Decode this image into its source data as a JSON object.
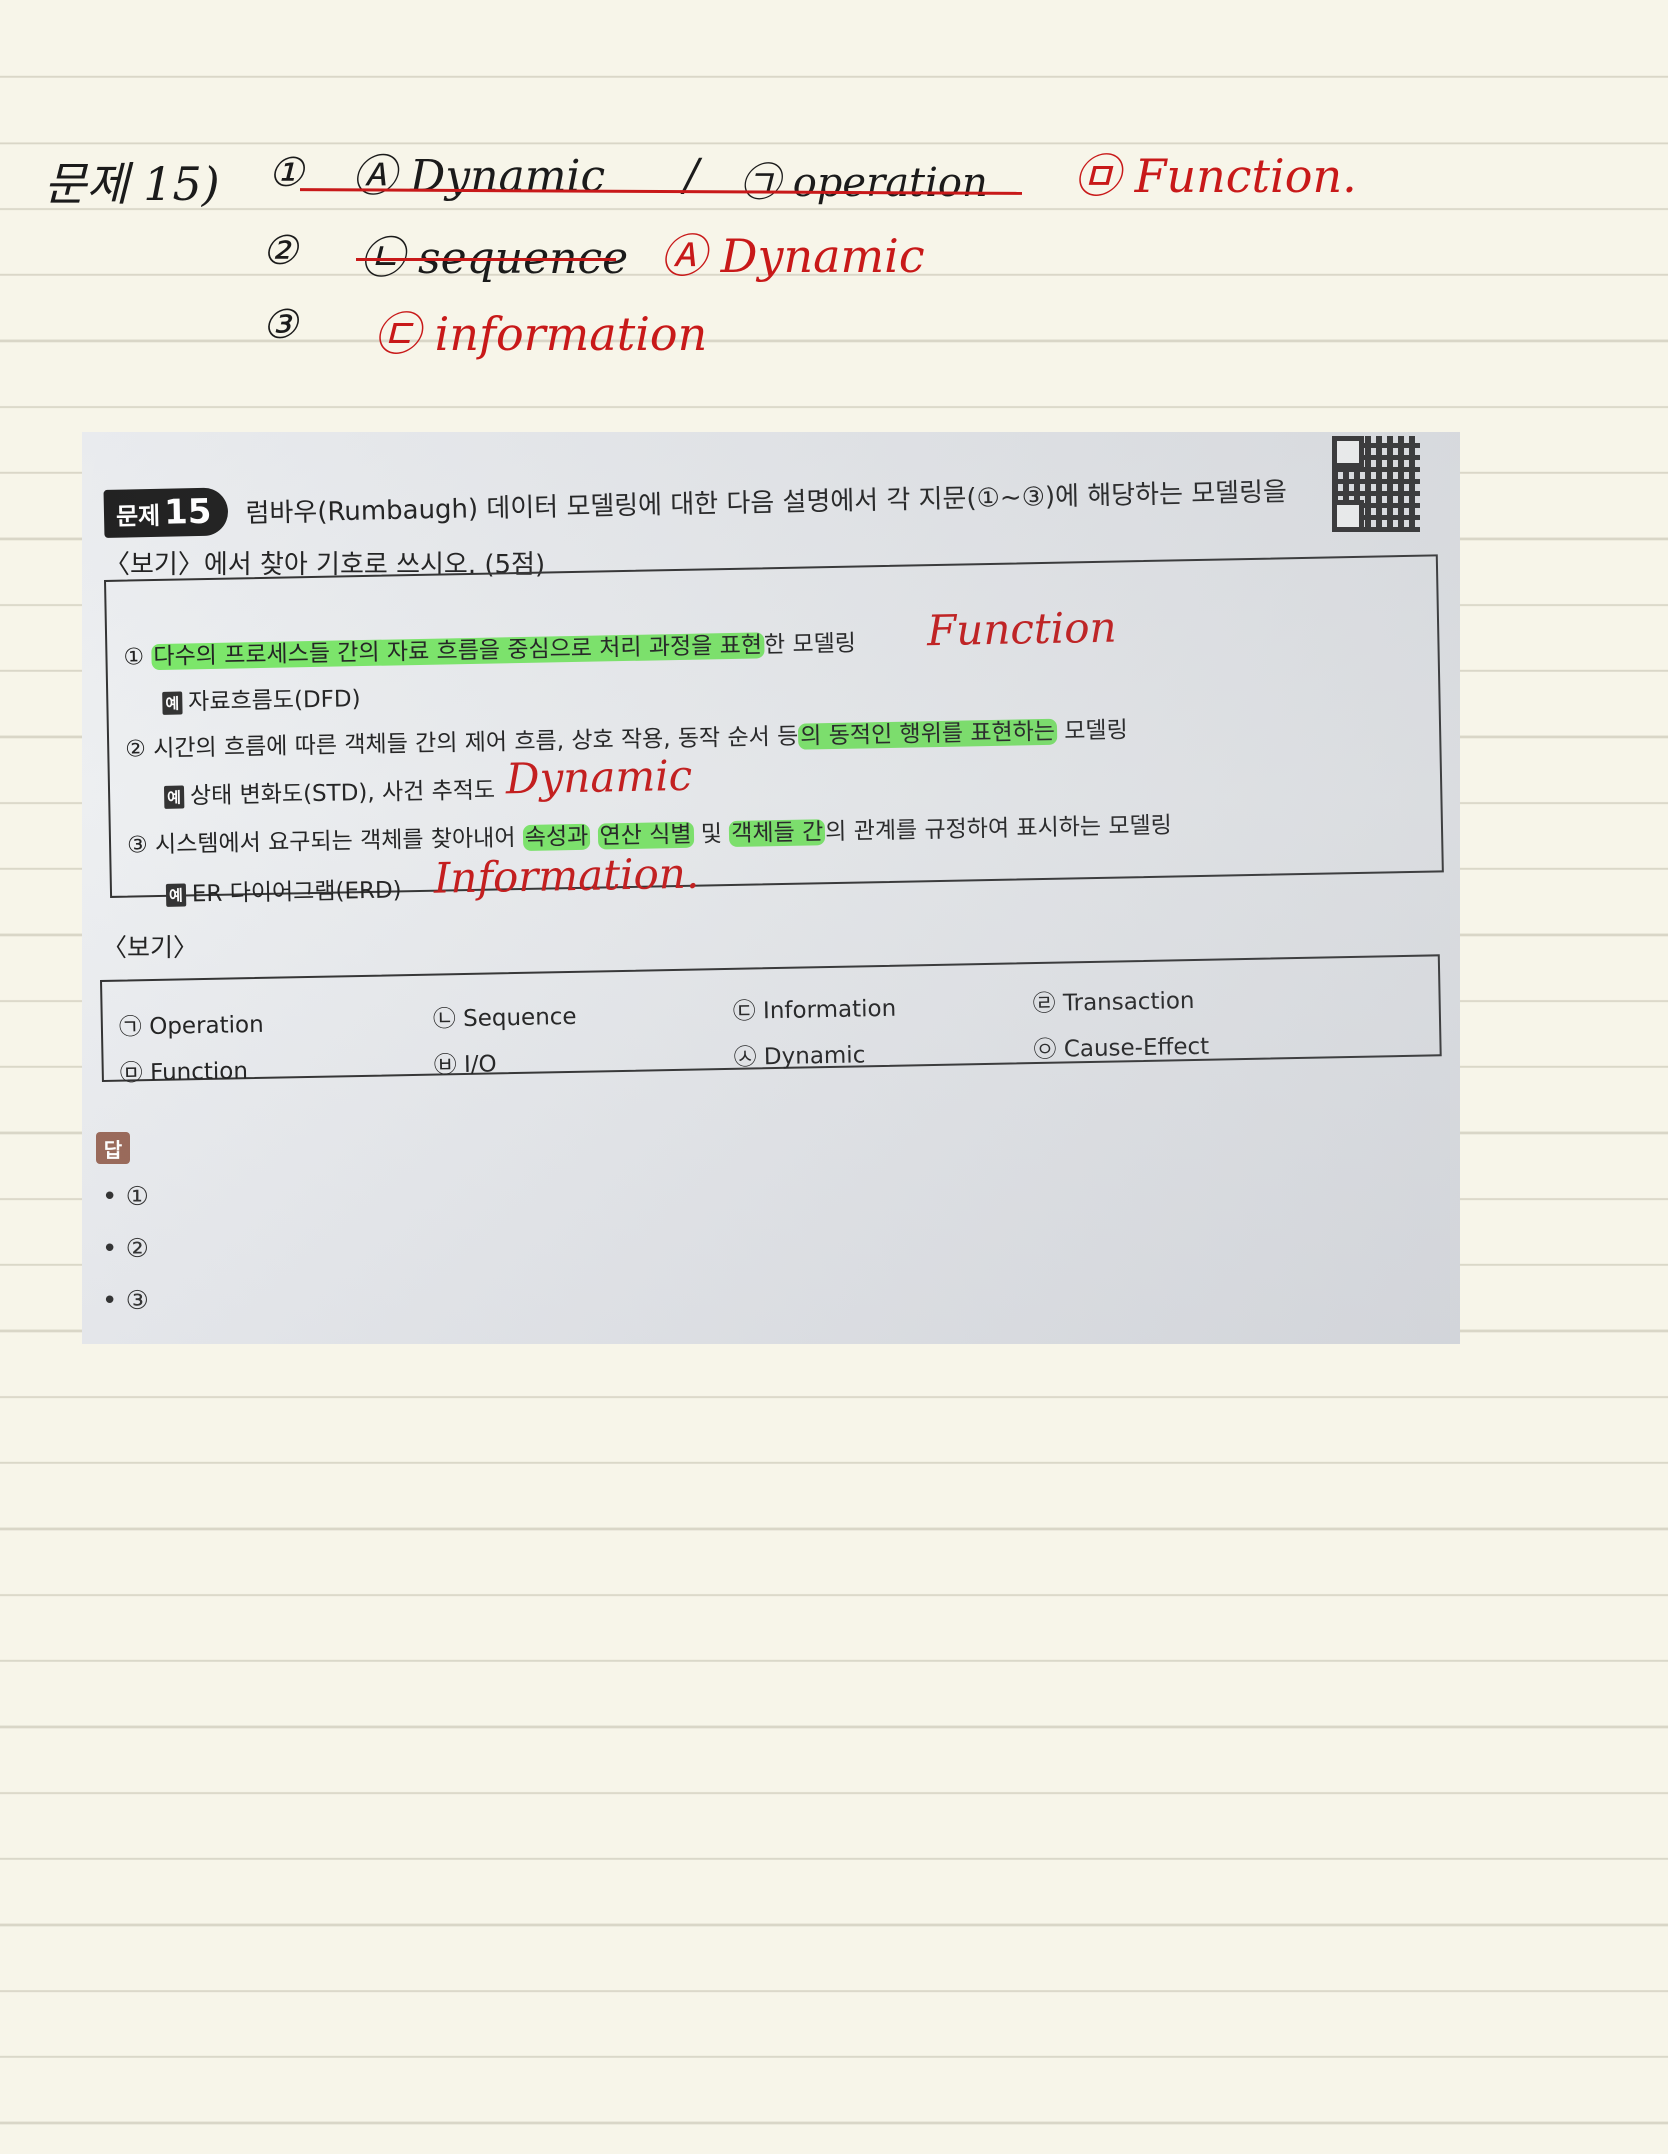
{
  "notes": {
    "prefix": "문제 15)",
    "n1": "①",
    "n1_struck": "Ⓐ Dynamic",
    "n1_slash": "/",
    "n1_struck2": "㉠ operation",
    "n1_answer": "㉤ Function.",
    "n2": "②",
    "n2_struck": "㉡ sequence",
    "n2_answer": "Ⓐ Dynamic",
    "n3": "③",
    "n3_answer": "㉢ information"
  },
  "question": {
    "badge_label": "문제",
    "badge_number": "15",
    "line1": "럼바우(Rumbaugh) 데이터 모델링에 대한 다음 설명에서 각 지문(①~③)에 해당하는 모델링을",
    "line2": "〈보기〉에서 찾아 기호로 쓰시오. (5점)",
    "items": [
      {
        "num": "①",
        "hl": "다수의 프로세스들 간의 자료 흐름을 중심으로 처리 과정을 표현",
        "rest": "한 모델링",
        "ex_tag": "예",
        "example": "자료흐름도(DFD)",
        "annotation": "Function"
      },
      {
        "num": "②",
        "pre": "시간의 흐름에 따른 객체들 간의 제어 흐름, 상호 작용, 동작 순서 등",
        "hl": "의 동적인 행위를 표현하는",
        "rest": " 모델링",
        "ex_tag": "예",
        "example": "상태 변화도(STD), 사건 추적도",
        "annotation": "Dynamic"
      },
      {
        "num": "③",
        "pre": "시스템에서 요구되는 객체를 찾아내어 ",
        "hl1": "속성과",
        "mid1": " ",
        "hl2": "연산 식별",
        "mid2": " 및 ",
        "hl3": "객체들 간",
        "rest": "의 관계를 규정하여 표시하는 모델링",
        "ex_tag": "예",
        "example": "ER 다이어그램(ERD)",
        "annotation": "Information."
      }
    ]
  },
  "bogi": {
    "label": "〈보기〉",
    "options": [
      "㉠ Operation",
      "㉡ Sequence",
      "㉢ Information",
      "㉣ Transaction",
      "㉤ Function",
      "㉥ I/O",
      "㉦ Dynamic",
      "㉧ Cause-Effect"
    ]
  },
  "answer": {
    "badge": "답",
    "lines": [
      "• ①",
      "• ②",
      "• ③"
    ]
  },
  "colors": {
    "paper": "#f7f5e9",
    "rule": "#d9d6c7",
    "ink_red": "#c81919",
    "highlight": "#7ce86a"
  }
}
